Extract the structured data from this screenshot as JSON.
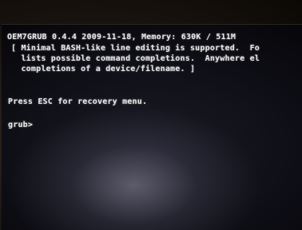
{
  "terminal": {
    "lines": [
      "OEM7GRUB 0.4.4 2009-11-18, Memory: 630K / 511M",
      "[ Minimal BASH-like line editing is supported.  Fo",
      "  lists possible command completions.  Anywhere el",
      "  completions of a device/filename. ]",
      "Press ESC for recovery menu.",
      "grub>"
    ]
  },
  "colors": {
    "text": "#e9e9e9",
    "background": "#0d0d14"
  }
}
